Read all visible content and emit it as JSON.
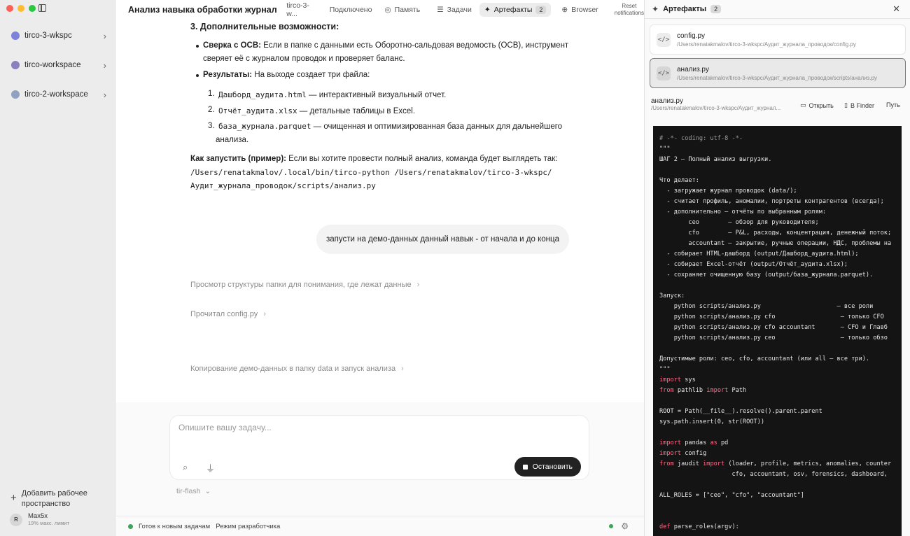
{
  "sidebar": {
    "workspaces": [
      {
        "label": "tirco-3-wkspc",
        "color": "#7c83d8"
      },
      {
        "label": "tirco-workspace",
        "color": "#8a7fbf"
      },
      {
        "label": "tirco-2-workspace",
        "color": "#8fa0c0"
      }
    ],
    "add_workspace": "Добавить рабочее пространство",
    "user_initial": "R",
    "user_name": "Max5x",
    "user_limit": "19% макс. лимит"
  },
  "topbar": {
    "title": "Анализ навыка обработки журнала п...",
    "workspace": "tirco-3-w...",
    "connected": "Подключено",
    "memory": "Память",
    "tasks": "Задачи",
    "artifacts": "Артефакты",
    "artifacts_count": "2",
    "browser": "Browser",
    "reset_line1": "Reset",
    "reset_line2": "notifications"
  },
  "chat": {
    "heading": "3. Дополнительные возможности:",
    "bullet1_bold": "Сверка с ОСВ:",
    "bullet1_text_a": " Если в папке с данными есть Оборотно-сальдовая ведомость (ОСВ), инструмент",
    "bullet1_text_b": "сверяет её с журналом проводок и проверяет баланс.",
    "bullet2_bold": "Результаты:",
    "bullet2_text": " На выходе создает три файла:",
    "items": [
      {
        "num": "1.",
        "code": "Дашборд_аудита.html",
        "text": " — интерактивный визуальный отчет."
      },
      {
        "num": "2.",
        "code": "Отчёт_аудита.xlsx",
        "text": " — детальные таблицы в Excel."
      },
      {
        "num": "3.",
        "code": "база_журнала.parquet",
        "text": " — очищенная и оптимизированная база данных для дальнейшего"
      }
    ],
    "item3_cont": "анализа.",
    "run_bold": "Как запустить (пример):",
    "run_text": " Если вы хотите провести полный анализ, команда будет выглядеть так:",
    "run_cmd_1": " /Users/renatakmalov/.local/bin/tirco-python /Users/renatakmalov/tirco-3-wkspc/",
    "run_cmd_2": "Аудит_журнала_проводок/scripts/анализ.py",
    "user_message": "запусти на демо-данных данный навык - от начала и до конца",
    "steps": [
      "Просмотр структуры папки для понимания, где лежат данные",
      "Прочитал config.py",
      "Копирование демо-данных в папку data и запуск анализа"
    ]
  },
  "composer": {
    "placeholder": "Опишите вашу задачу...",
    "stop_label": "Остановить",
    "model": "tir-flash"
  },
  "status": {
    "ready": "Готов к новым задачам",
    "dev_mode": "Режим разработчика"
  },
  "artifacts": {
    "title": "Артефакты",
    "count": "2",
    "files": [
      {
        "name": "config.py",
        "path": "/Users/renatakmalov/tirco-3-wkspc/Аудит_журнала_проводок/config.py"
      },
      {
        "name": "анализ.py",
        "path": "/Users/renatakmalov/tirco-3-wkspc/Аудит_журнала_проводок/scripts/анализ.py"
      }
    ],
    "preview_name": "анализ.py",
    "preview_path": "/Users/renatakmalov/tirco-3-wkspc/Аудит_журнал...",
    "open_label": "Открыть",
    "finder_label": "В Finder",
    "path_label": "Путь",
    "code_lines": [
      "# -*- coding: utf-8 -*-",
      "\"\"\"",
      "ШАГ 2 — Полный анализ выгрузки.",
      "",
      "Что делает:",
      "  - загружает журнал проводок (data/);",
      "  - считает профиль, аномалии, портреты контрагентов (всегда);",
      "  - дополнительно — отчёты по выбранным ролям:",
      "        ceo        — обзор для руководителя;",
      "        cfo        — P&L, расходы, концентрация, денежный поток;",
      "        accountant — закрытие, ручные операции, НДС, проблемы на",
      "  - собирает HTML-дашборд (output/Дашборд_аудита.html);",
      "  - собирает Excel-отчёт (output/Отчёт_аудита.xlsx);",
      "  - сохраняет очищенную базу (output/база_журнала.parquet).",
      "",
      "Запуск:",
      "    python scripts/анализ.py                     — все роли",
      "    python scripts/анализ.py cfo                  — только CFO",
      "    python scripts/анализ.py cfo accountant       — CFO и Главб",
      "    python scripts/анализ.py ceo                  — только обзо",
      "",
      "Допустимые роли: ceo, cfo, accountant (или all — все три).",
      "\"\"\"",
      "import sys",
      "from pathlib import Path",
      "",
      "ROOT = Path(__file__).resolve().parent.parent",
      "sys.path.insert(0, str(ROOT))",
      "",
      "import pandas as pd",
      "import config",
      "from jaudit import (loader, profile, metrics, anomalies, counter",
      "                    cfo, accountant, osv, forensics, dashboard,",
      "",
      "ALL_ROLES = [\"ceo\", \"cfo\", \"accountant\"]",
      "",
      "",
      "def parse_roles(argv):"
    ]
  }
}
